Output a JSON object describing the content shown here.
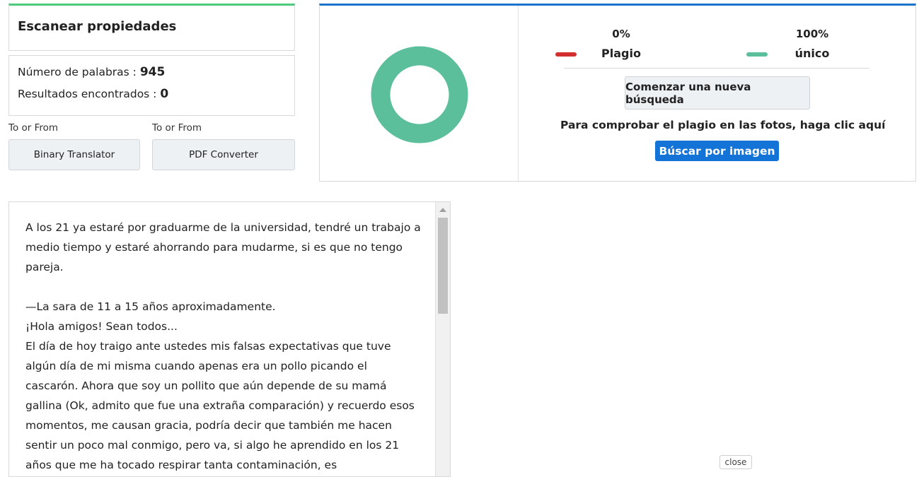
{
  "scan": {
    "title": "Escanear propiedades"
  },
  "stats": {
    "word_count_label": "Número de palabras :",
    "word_count": "945",
    "results_label": "Resultados encontrados :",
    "results": "0"
  },
  "tools": [
    {
      "caption": "To or From",
      "label": "Binary Translator"
    },
    {
      "caption": "To or From",
      "label": "PDF Converter"
    }
  ],
  "results_panel": {
    "plagiarism": {
      "percent_text": "0%",
      "label": "Plagio",
      "color": "#d32f2f",
      "value": 0
    },
    "unique": {
      "percent_text": "100%",
      "label": "único",
      "color": "#5bbf9b",
      "value": 100
    },
    "new_search_button": "Comenzar una nueva búsqueda",
    "photo_hint": "Para comprobar el plagio en las fotos, haga clic aquí",
    "image_search_button": "Búscar por imagen"
  },
  "text": {
    "paragraphs": [
      "A los 21 ya estaré por graduarme de la universidad, tendré un trabajo a medio tiempo y estaré ahorrando para mudarme, si es que no tengo pareja.",
      "",
      "—La sara de 11 a 15 años aproximadamente.",
      "¡Hola amigos! Sean todos...",
      "El día de hoy traigo ante ustedes mis falsas expectativas que tuve algún día de mi misma cuando apenas era un pollo picando el cascarón. Ahora que soy un pollito que aún depende de su mamá gallina (Ok, admito que fue una extraña comparación) y recuerdo esos momentos, me causan gracia, podría decir que también me hacen sentir un poco mal conmigo, pero va, si algo he aprendido en los 21 años que me ha tocado respirar tanta contaminación, es"
    ]
  },
  "close_button": "close"
}
